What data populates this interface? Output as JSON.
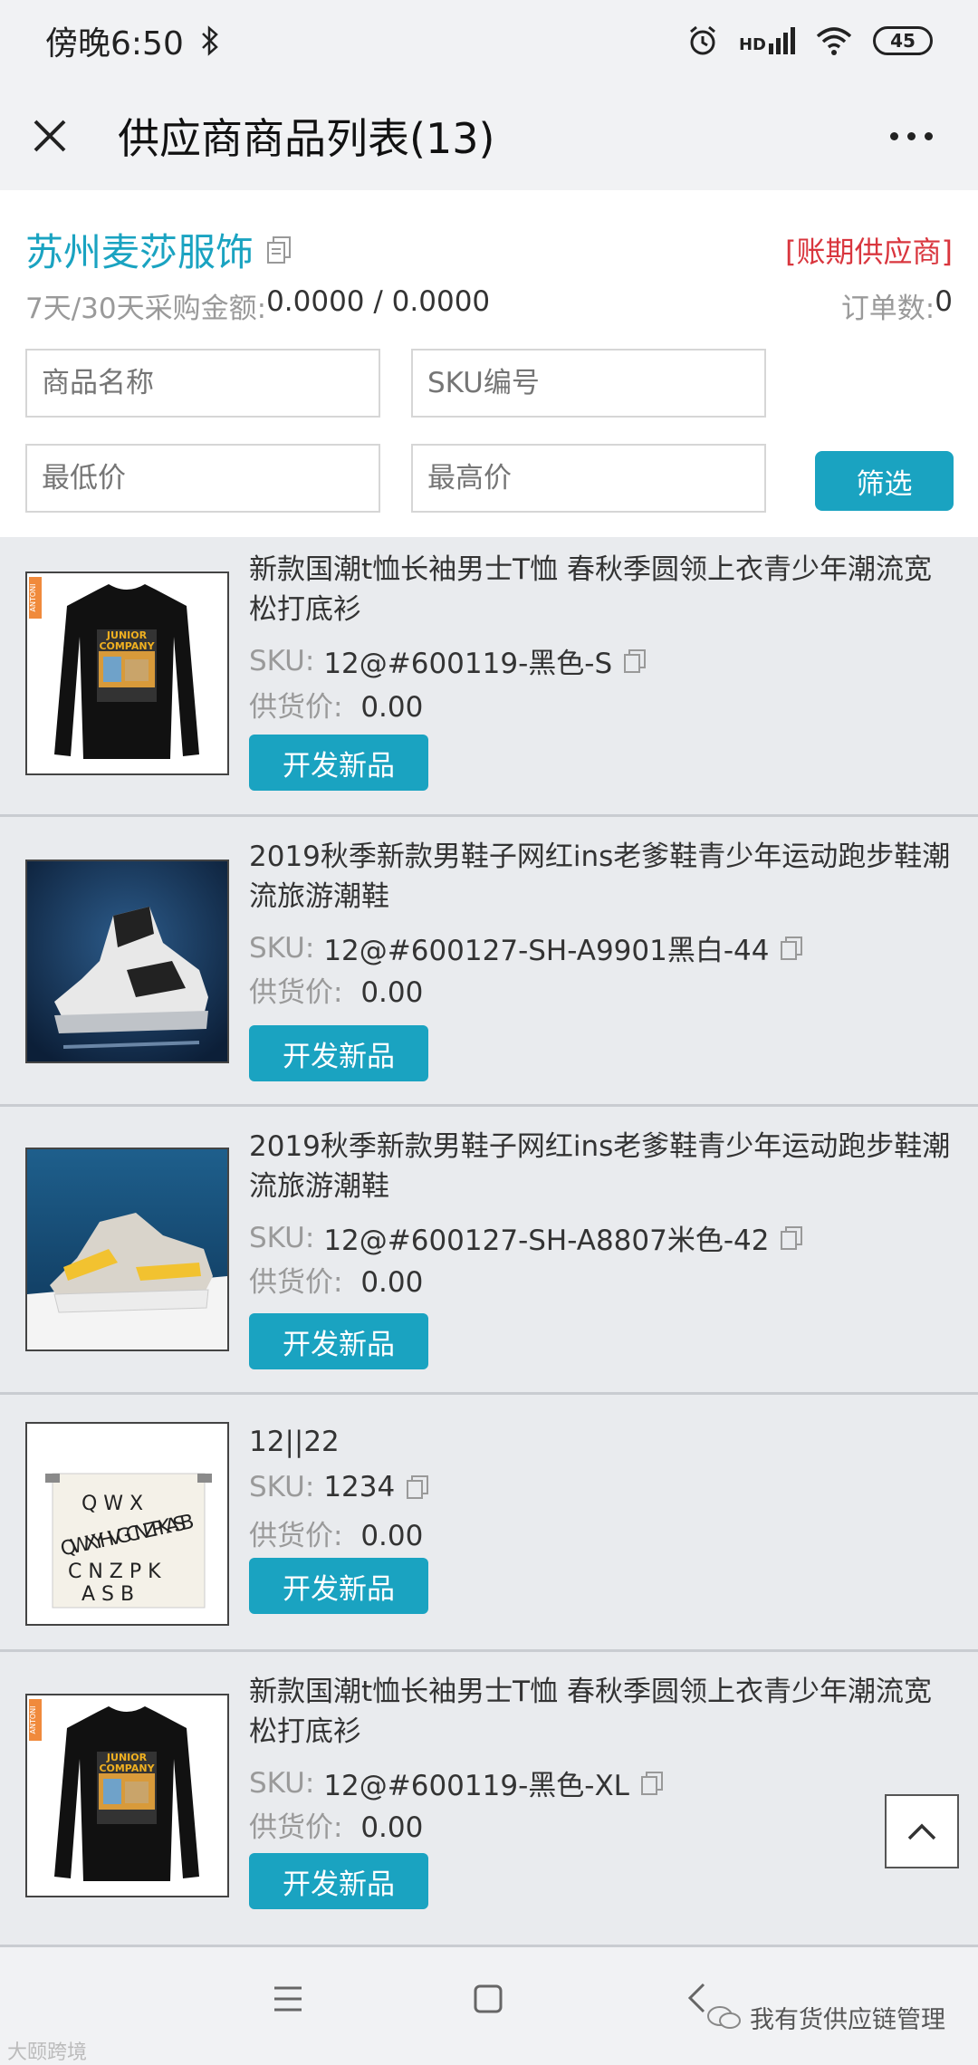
{
  "status_bar": {
    "time": "傍晚6:50",
    "battery": "45",
    "hd": "HD"
  },
  "title_bar": {
    "title": "供应商商品列表(13)"
  },
  "supplier": {
    "name": "苏州麦莎服饰",
    "type": "[账期供应商]",
    "amount_label": "7天/30天采购金额:",
    "amount_value": "0.0000 / 0.0000",
    "order_label": "订单数:",
    "order_value": "0"
  },
  "filters": {
    "name_placeholder": "商品名称",
    "sku_placeholder": "SKU编号",
    "min_price_placeholder": "最低价",
    "max_price_placeholder": "最高价",
    "filter_label": "筛选"
  },
  "labels": {
    "sku": "SKU:",
    "price": "供货价:",
    "develop": "开发新品"
  },
  "products": [
    {
      "name": "新款国潮t恤长袖男士T恤 春秋季圆领上衣青少年潮流宽松打底衫",
      "sku": "12@#600119-黑色-S",
      "price": "0.00"
    },
    {
      "name": "2019秋季新款男鞋子网红ins老爹鞋青少年运动跑步鞋潮流旅游潮鞋",
      "sku": "12@#600127-SH-A9901黑白-44",
      "price": "0.00"
    },
    {
      "name": "2019秋季新款男鞋子网红ins老爹鞋青少年运动跑步鞋潮流旅游潮鞋",
      "sku": "12@#600127-SH-A8807米色-42",
      "price": "0.00"
    },
    {
      "name": "12||22",
      "sku": "1234",
      "price": "0.00"
    },
    {
      "name": "新款国潮t恤长袖男士T恤 春秋季圆领上衣青少年潮流宽松打底衫",
      "sku": "12@#600119-黑色-XL",
      "price": "0.00"
    }
  ],
  "product_image_text": {
    "tshirt_top": "JUNIOR",
    "tshirt_bottom": "COMPANY",
    "tag": "ANTONI",
    "bag_letters": "Q W X Y H V G C N Z P K A S B"
  },
  "watermark": {
    "left": "大颐跨境",
    "right": "我有货供应链管理"
  },
  "colors": {
    "accent": "#1aa3c1",
    "supplier_type": "#d9363e"
  }
}
